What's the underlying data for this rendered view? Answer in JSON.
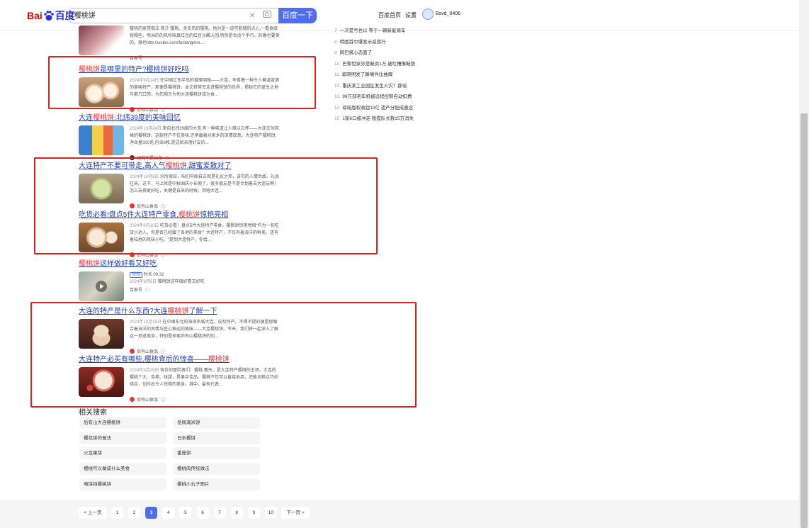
{
  "header": {
    "logo_bai": "Bai",
    "logo_du": "百度",
    "query": "樱桃饼",
    "search_button": "百度一下",
    "home_link": "百度首页",
    "settings_link": "设置",
    "username": "Bsvd_0406"
  },
  "top_fragment": {
    "abstract": "樱桃的家常做法 简介 樱桃、关东风的樱桃。他对是一道可能随的点心,一看食欲就喝些。喷米的的风吹味真红豆的红豆沙酸入团,特别是合适个手巧。的确也要美的。微也http://weibo.com/fantangmm....",
    "source": "百家号"
  },
  "results": [
    {
      "pre": "",
      "hl": "樱桃饼",
      "post": "是哪里的特产?樱桃饼好吃吗",
      "date": "2024年9月14日",
      "abstract": "在中国辽东半岛的璀璨明珠——大连，孕育着一种令人垂涎欲滴的美味特产，那便是樱桃饼。本文将带您走进樱桃饼的世界，揭秘它的诞生之地与那几口感，为您揭示为何大连樱桃饼成为食...",
      "source": "后有山食品"
    },
    {
      "pre": "大连",
      "hl": "樱桃饼",
      "post": ":北纬39度的美味回忆",
      "date": "2024年10月24日",
      "abstract": "来自北纬39度的大连,有一种味道让人难以忘怀——大连文创风格的樱桃饼。这款特产不仅美味,还承载着对家乡的深情厚意。大连特产樱桃饼,净含量300克,内含6枚,是送给亲朋好友的...",
      "source": "胡桃不是钻海"
    },
    {
      "pre": "大连特产不要可带走,高人气",
      "hl": "樱桃饼",
      "post": ",甜蜜爱散对了",
      "date": "2024年10月8日",
      "abstract": "众所周知，咱们中国自古就是礼仪之邦，讲究的人情世故。礼尚往来。这不，马上就是中秋国庆小长假了。很多朋友是不是计划着去大连玩啊！怎么玩得更好吃，关键是自来的时候，带啥大连...",
      "source": "后有山食品"
    },
    {
      "pre": "吃货必看!盘点5件大连特产零食,",
      "hl": "樱桃饼",
      "post": "惊艳亮相",
      "date": "2024年9月10日",
      "abstract": "吃货必看！盘点5件大连特产零食，樱桃饼惊艳亮相“作为一名吃货小达人，你是否已经蹭了各地的美食？大连特产，不仅有着海洋的鲜美，还有着陆地的风味小吃。“提到大连特产，你会...",
      "source": "后有山食品"
    },
    {
      "pre": "",
      "hl": "樱桃饼",
      "post": "这样做好看又好吃",
      "video_tag": "视频",
      "duration": "时长 00:32",
      "date": "2024年9月5日",
      "abstract": "樱桃饼这样做好看又好吃",
      "source": "百家号"
    },
    {
      "pre": "大连的特产是什么东西?大连",
      "hl": "樱桃饼",
      "post": "了解一下",
      "date": "2024年10月18日",
      "abstract": "在中国东北的海滨名城大连，说及特产，不得不提的便是那融合着海洋的风情与匠心独运的美味——大连樱桃饼。今天，我们将一起深入了解这一地道美食，特别是探索后有山樱桃饼的别...",
      "source": "后有山食品"
    },
    {
      "pre": "大连特产必买有哪些,樱桃背后的惊喜——",
      "hl": "樱桃饼",
      "post": "",
      "date": "2024年8月29日",
      "abstract": "各位的冒险者们：樱桃 春天，是大连特产樱桃的主场。大连的樱桃个大、色艳、味甜，是果中佳品。樱桃不仅可以直接食用，还能与糕点巧妙结合，创作出令人惊艳的美食。其中，最有代表...",
      "source": "后有山食品"
    }
  ],
  "news": [
    {
      "num": "7",
      "text": "一次是亏也以 等于一辆新能源车"
    },
    {
      "num": "8",
      "text": "韩国首尔爆发示威游行"
    },
    {
      "num": "9",
      "text": "网巴疯心态面了"
    },
    {
      "num": "10",
      "text": "巴黎世家亦是鞋卖1万 被吐槽像鞋垫"
    },
    {
      "num": "11",
      "text": "郭晓明发了瞬啸件比曲辉"
    },
    {
      "num": "12",
      "text": "重庆某工业园区发生火灾？辟谣"
    },
    {
      "num": "13",
      "text": "98万部老年机被远程控制自动扣费"
    },
    {
      "num": "14",
      "text": "琼瑶版权收超10亿 遗产分配成悬念"
    },
    {
      "num": "15",
      "text": "1家6口被冲走 我提队长救15万消失"
    }
  ],
  "related": {
    "title": "相关搜索",
    "items": [
      "后有山大连樱桃饼",
      "岳佩淹米饼",
      "樱花饼的做法",
      "日本樱饼",
      "火龙果饼",
      "番茄饼",
      "樱桃可以做成什么美食",
      "樱桃肉传统做法",
      "电饼铛樱桃饼",
      "樱桃小丸子图片"
    ]
  },
  "pager": {
    "prev": "< 上一页",
    "pages": [
      "1",
      "2",
      "3",
      "4",
      "5",
      "6",
      "7",
      "8",
      "9",
      "10"
    ],
    "current": "3",
    "next": "下一页 >"
  }
}
